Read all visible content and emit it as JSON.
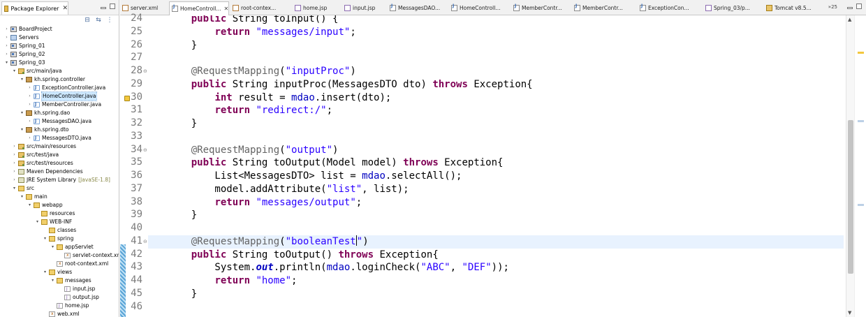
{
  "package_explorer": {
    "title": "Package Explorer",
    "close_label": "✕",
    "tree": [
      {
        "label": "BoardProject",
        "icon": "project-icon",
        "twisty": "closed"
      },
      {
        "label": "Servers",
        "icon": "server-folder-icon",
        "twisty": "closed"
      },
      {
        "label": "Spring_01",
        "icon": "project-icon",
        "twisty": "closed"
      },
      {
        "label": "Spring_02",
        "icon": "project-icon",
        "twisty": "closed"
      },
      {
        "label": "Spring_03",
        "icon": "project-icon",
        "twisty": "open"
      },
      {
        "label": "src/main/java",
        "icon": "source-folder-icon",
        "twisty": "open"
      },
      {
        "label": "kh.spring.controller",
        "icon": "package-icon",
        "twisty": "open"
      },
      {
        "label": "ExceptionController.java",
        "icon": "java-file-icon",
        "twisty": "closed"
      },
      {
        "label": "HomeController.java",
        "icon": "java-file-icon",
        "twisty": "closed",
        "selected": true
      },
      {
        "label": "MemberController.java",
        "icon": "java-file-icon",
        "twisty": "closed"
      },
      {
        "label": "kh.spring.dao",
        "icon": "package-icon",
        "twisty": "open"
      },
      {
        "label": "MessagesDAO.java",
        "icon": "java-file-icon",
        "twisty": "closed"
      },
      {
        "label": "kh.spring.dto",
        "icon": "package-icon",
        "twisty": "open"
      },
      {
        "label": "MessagesDTO.java",
        "icon": "java-file-icon",
        "twisty": "closed"
      },
      {
        "label": "src/main/resources",
        "icon": "source-folder-icon",
        "twisty": "closed"
      },
      {
        "label": "src/test/java",
        "icon": "source-folder-icon",
        "twisty": "closed"
      },
      {
        "label": "src/test/resources",
        "icon": "source-folder-icon",
        "twisty": "closed"
      },
      {
        "label": "Maven Dependencies",
        "icon": "library-icon",
        "twisty": "closed"
      },
      {
        "label": "JRE System Library",
        "decoration": "[JavaSE-1.8]",
        "icon": "library-icon",
        "twisty": "closed"
      },
      {
        "label": "src",
        "icon": "folder-icon",
        "twisty": "open"
      },
      {
        "label": "main",
        "icon": "folder-icon",
        "twisty": "open"
      },
      {
        "label": "webapp",
        "icon": "folder-icon",
        "twisty": "open"
      },
      {
        "label": "resources",
        "icon": "folder-icon",
        "twisty": "none"
      },
      {
        "label": "WEB-INF",
        "icon": "folder-icon",
        "twisty": "open"
      },
      {
        "label": "classes",
        "icon": "folder-icon",
        "twisty": "none"
      },
      {
        "label": "spring",
        "icon": "folder-icon",
        "twisty": "open"
      },
      {
        "label": "appServlet",
        "icon": "folder-icon",
        "twisty": "open"
      },
      {
        "label": "servlet-context.xn",
        "icon": "xml-file-icon",
        "twisty": "none"
      },
      {
        "label": "root-context.xml",
        "icon": "xml-file-icon",
        "twisty": "none"
      },
      {
        "label": "views",
        "icon": "folder-icon",
        "twisty": "open"
      },
      {
        "label": "messages",
        "icon": "folder-icon",
        "twisty": "open"
      },
      {
        "label": "input.jsp",
        "icon": "jsp-file-icon",
        "twisty": "none"
      },
      {
        "label": "output.jsp",
        "icon": "jsp-file-icon",
        "twisty": "none"
      },
      {
        "label": "home.jsp",
        "icon": "jsp-file-icon",
        "twisty": "none"
      },
      {
        "label": "web.xml",
        "icon": "xml-file-icon",
        "twisty": "none"
      }
    ]
  },
  "editor": {
    "tabs": [
      {
        "label": "server.xml",
        "icon": "xml-file-icon"
      },
      {
        "label": "HomeControll...",
        "icon": "java-file-icon",
        "active": true,
        "close": "✕"
      },
      {
        "label": "root-contex...",
        "icon": "xml-file-icon"
      },
      {
        "label": "home.jsp",
        "icon": "jsp-file-icon"
      },
      {
        "label": "input.jsp",
        "icon": "jsp-file-icon"
      },
      {
        "label": "MessagesDAO...",
        "icon": "java-file-icon"
      },
      {
        "label": "HomeControll...",
        "icon": "java-file-icon"
      },
      {
        "label": "MemberContr...",
        "icon": "java-file-icon"
      },
      {
        "label": "MemberContr...",
        "icon": "java-file-icon"
      },
      {
        "label": "ExceptionCon...",
        "icon": "java-file-icon"
      },
      {
        "label": "Spring_03/p...",
        "icon": "jsp-file-icon"
      },
      {
        "label": "Tomcat v8.5...",
        "icon": "tomcat-icon"
      }
    ],
    "tab_overflow": "»25",
    "line_numbers": [
      "24",
      "25",
      "26",
      "27",
      "28",
      "29",
      "30",
      "31",
      "32",
      "33",
      "34",
      "35",
      "36",
      "37",
      "38",
      "39",
      "40",
      "41",
      "42",
      "43",
      "44",
      "45",
      "46"
    ],
    "fold_markers": {
      "28": "⊖",
      "34": "⊖",
      "41": "⊖"
    },
    "current_line": "41",
    "code_lines": [
      [
        {
          "t": "    "
        },
        {
          "t": "public",
          "c": "kw"
        },
        {
          "t": " String toInput() {"
        }
      ],
      [
        {
          "t": "        "
        },
        {
          "t": "return",
          "c": "kw"
        },
        {
          "t": " "
        },
        {
          "t": "\"messages/input\"",
          "c": "st"
        },
        {
          "t": ";"
        }
      ],
      [
        {
          "t": "    }"
        }
      ],
      [
        {
          "t": ""
        }
      ],
      [
        {
          "t": "    "
        },
        {
          "t": "@RequestMapping",
          "c": "an"
        },
        {
          "t": "("
        },
        {
          "t": "\"inputProc\"",
          "c": "st"
        },
        {
          "t": ")"
        }
      ],
      [
        {
          "t": "    "
        },
        {
          "t": "public",
          "c": "kw"
        },
        {
          "t": " String inputProc(MessagesDTO dto) "
        },
        {
          "t": "throws",
          "c": "kw"
        },
        {
          "t": " Exception{"
        }
      ],
      [
        {
          "t": "        "
        },
        {
          "t": "int",
          "c": "kw"
        },
        {
          "t": " result = "
        },
        {
          "t": "mdao",
          "c": "fd"
        },
        {
          "t": ".insert(dto);"
        }
      ],
      [
        {
          "t": "        "
        },
        {
          "t": "return",
          "c": "kw"
        },
        {
          "t": " "
        },
        {
          "t": "\"redirect:/\"",
          "c": "st"
        },
        {
          "t": ";"
        }
      ],
      [
        {
          "t": "    }"
        }
      ],
      [
        {
          "t": ""
        }
      ],
      [
        {
          "t": "    "
        },
        {
          "t": "@RequestMapping",
          "c": "an"
        },
        {
          "t": "("
        },
        {
          "t": "\"output\"",
          "c": "st"
        },
        {
          "t": ")"
        }
      ],
      [
        {
          "t": "    "
        },
        {
          "t": "public",
          "c": "kw"
        },
        {
          "t": " String toOutput(Model model) "
        },
        {
          "t": "throws",
          "c": "kw"
        },
        {
          "t": " Exception{"
        }
      ],
      [
        {
          "t": "        List<MessagesDTO> list = "
        },
        {
          "t": "mdao",
          "c": "fd"
        },
        {
          "t": ".selectAll();"
        }
      ],
      [
        {
          "t": "        model.addAttribute("
        },
        {
          "t": "\"list\"",
          "c": "st"
        },
        {
          "t": ", list);"
        }
      ],
      [
        {
          "t": "        "
        },
        {
          "t": "return",
          "c": "kw"
        },
        {
          "t": " "
        },
        {
          "t": "\"messages/output\"",
          "c": "st"
        },
        {
          "t": ";"
        }
      ],
      [
        {
          "t": "    }"
        }
      ],
      [
        {
          "t": ""
        }
      ],
      [
        {
          "t": "    "
        },
        {
          "t": "@RequestMapping",
          "c": "an"
        },
        {
          "t": "("
        },
        {
          "t": "\"booleanTest",
          "c": "st"
        },
        {
          "t": "|",
          "c": "caret"
        },
        {
          "t": "\"",
          "c": "st"
        },
        {
          "t": ")"
        }
      ],
      [
        {
          "t": "    "
        },
        {
          "t": "public",
          "c": "kw"
        },
        {
          "t": " String toOutput() "
        },
        {
          "t": "throws",
          "c": "kw"
        },
        {
          "t": " Exception{"
        }
      ],
      [
        {
          "t": "        System."
        },
        {
          "t": "out",
          "c": "sfd"
        },
        {
          "t": ".println("
        },
        {
          "t": "mdao",
          "c": "fd"
        },
        {
          "t": ".loginCheck("
        },
        {
          "t": "\"ABC\"",
          "c": "st"
        },
        {
          "t": ", "
        },
        {
          "t": "\"DEF\"",
          "c": "st"
        },
        {
          "t": "));"
        }
      ],
      [
        {
          "t": "        "
        },
        {
          "t": "return",
          "c": "kw"
        },
        {
          "t": " "
        },
        {
          "t": "\"home\"",
          "c": "st"
        },
        {
          "t": ";"
        }
      ],
      [
        {
          "t": "    }"
        }
      ],
      [
        {
          "t": ""
        }
      ]
    ]
  },
  "colors": {
    "keyword": "#7f0055",
    "string": "#2a00ff",
    "annotation": "#646464",
    "field": "#0000c0",
    "current_line": "#e8f2fe",
    "selection": "#cde8ff"
  }
}
